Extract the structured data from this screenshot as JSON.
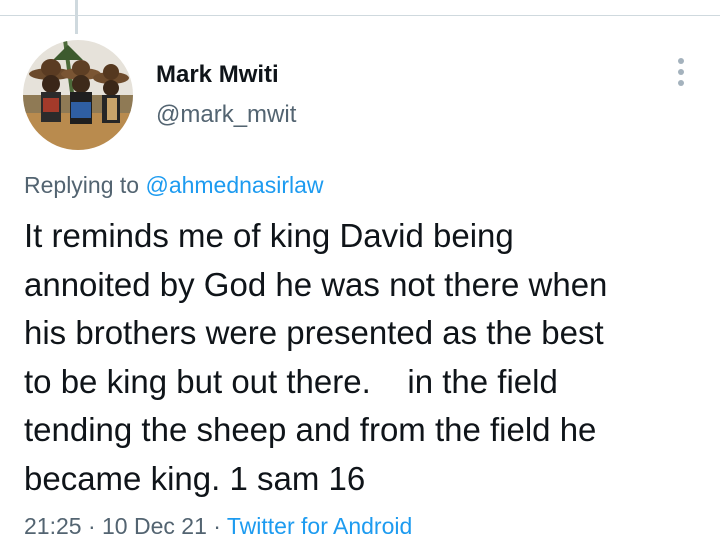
{
  "author": {
    "name": "Mark Mwiti",
    "handle": "@mark_mwit"
  },
  "reply": {
    "prefix": "Replying to ",
    "mention": "@ahmednasirlaw"
  },
  "tweet": {
    "text": "It reminds me of king David being\nannoited by God he was not there when\nhis brothers were presented as the best\nto be king but out there.    in the field\ntending the sheep and from the field he\nbecame king. 1 sam 16"
  },
  "meta": {
    "time": "21:25",
    "sep1": " · ",
    "date": "10 Dec 21",
    "sep2": " · ",
    "source": "Twitter for Android"
  },
  "icons": {
    "more": "more-vertical-icon"
  },
  "colors": {
    "text": "#0f1419",
    "secondary": "#536471",
    "link": "#1d9bf0",
    "divider": "#cfd9de"
  }
}
